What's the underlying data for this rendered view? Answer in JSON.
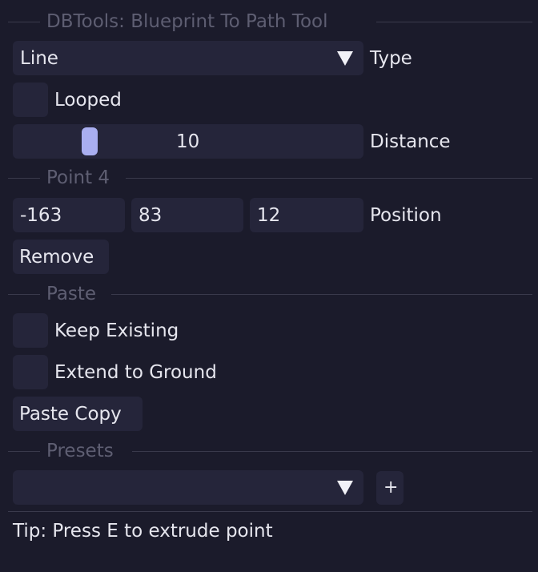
{
  "window": {
    "title": "DBTools: Blueprint To Path Tool"
  },
  "colors": {
    "background": "#1b1b2b",
    "frame": "#25253a",
    "separator": "#3a3a4c",
    "grab": "#a9aef0"
  },
  "type_combo": {
    "value": "Line",
    "label": "Type"
  },
  "looped_checkbox": {
    "label": "Looped",
    "checked": false
  },
  "distance_slider": {
    "value": "10",
    "label": "Distance"
  },
  "point_section": {
    "title": "Point 4"
  },
  "position": {
    "x": "-163",
    "y": "83",
    "z": "12",
    "label": "Position"
  },
  "remove_button": {
    "label": "Remove"
  },
  "paste_section": {
    "title": "Paste"
  },
  "keep_existing_checkbox": {
    "label": "Keep Existing",
    "checked": false
  },
  "extend_ground_checkbox": {
    "label": "Extend to Ground",
    "checked": false
  },
  "paste_copy_button": {
    "label": "Paste Copy"
  },
  "presets_section": {
    "title": "Presets"
  },
  "presets_combo": {
    "value": ""
  },
  "add_preset_button": {
    "label": "+"
  },
  "tip": {
    "text": "Tip: Press E to extrude point"
  }
}
